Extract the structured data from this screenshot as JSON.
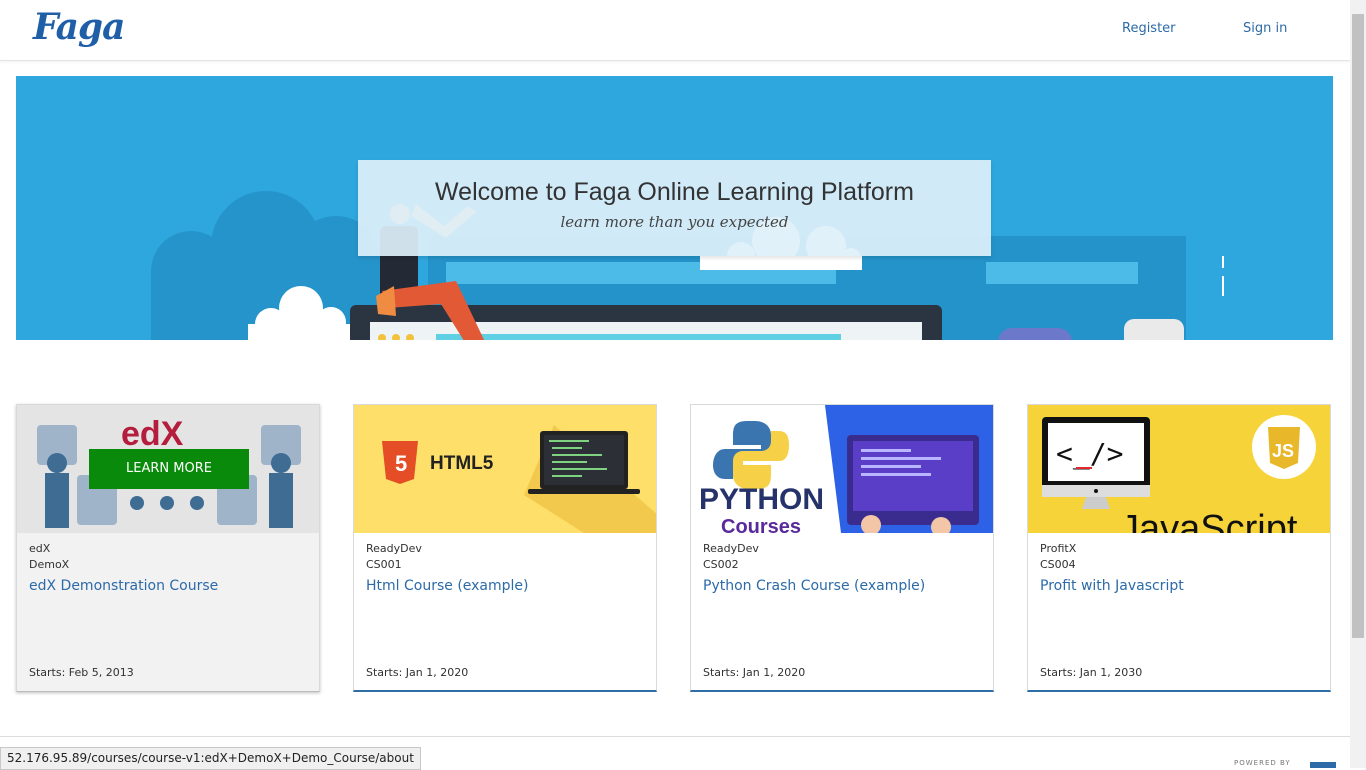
{
  "header": {
    "logo_text": "Faga",
    "nav": {
      "register": "Register",
      "sign_in": "Sign in"
    }
  },
  "hero": {
    "title": "Welcome to Faga Online Learning Platform",
    "subtitle": "learn more than you expected"
  },
  "courses": [
    {
      "org": "edX",
      "code": "DemoX",
      "title": "edX Demonstration Course",
      "start": "Starts: Feb 5, 2013",
      "overlay_button": "LEARN MORE",
      "image_text": "edX"
    },
    {
      "org": "ReadyDev",
      "code": "CS001",
      "title": "Html Course (example)",
      "start": "Starts: Jan 1, 2020",
      "image_text": "HTML5"
    },
    {
      "org": "ReadyDev",
      "code": "CS002",
      "title": "Python Crash Course (example)",
      "start": "Starts: Jan 1, 2020",
      "image_text": "PYTHON",
      "image_subtext": "Courses"
    },
    {
      "org": "ProfitX",
      "code": "CS004",
      "title": "Profit with Javascript",
      "start": "Starts: Jan 1, 2030",
      "image_text": "JavaScript",
      "image_badge": "JS",
      "image_code": "<_/>"
    }
  ],
  "status_bar": {
    "url": "52.176.95.89/courses/course-v1:edX+DemoX+Demo_Course/about"
  },
  "footer": {
    "powered_by": "POWERED BY"
  },
  "colors": {
    "brand": "#1f5fa8",
    "hero_bg": "#2ea7de",
    "link": "#2c6aa8",
    "learn_more": "#0a8a0a",
    "html_bg": "#fddf6a",
    "js_bg": "#f7d33a"
  }
}
